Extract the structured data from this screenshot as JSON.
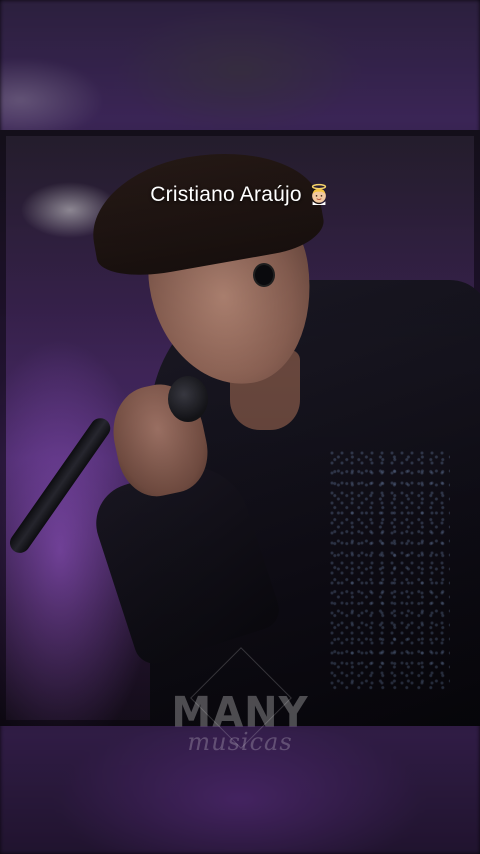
{
  "video": {
    "caption": "Cristiano Araújo",
    "caption_emoji": "angel-emoji"
  },
  "watermark": {
    "main": "MANY",
    "sub": "musicas"
  },
  "colors": {
    "stage_purple": "#4a2a6a",
    "caption_text": "#ffffff"
  }
}
